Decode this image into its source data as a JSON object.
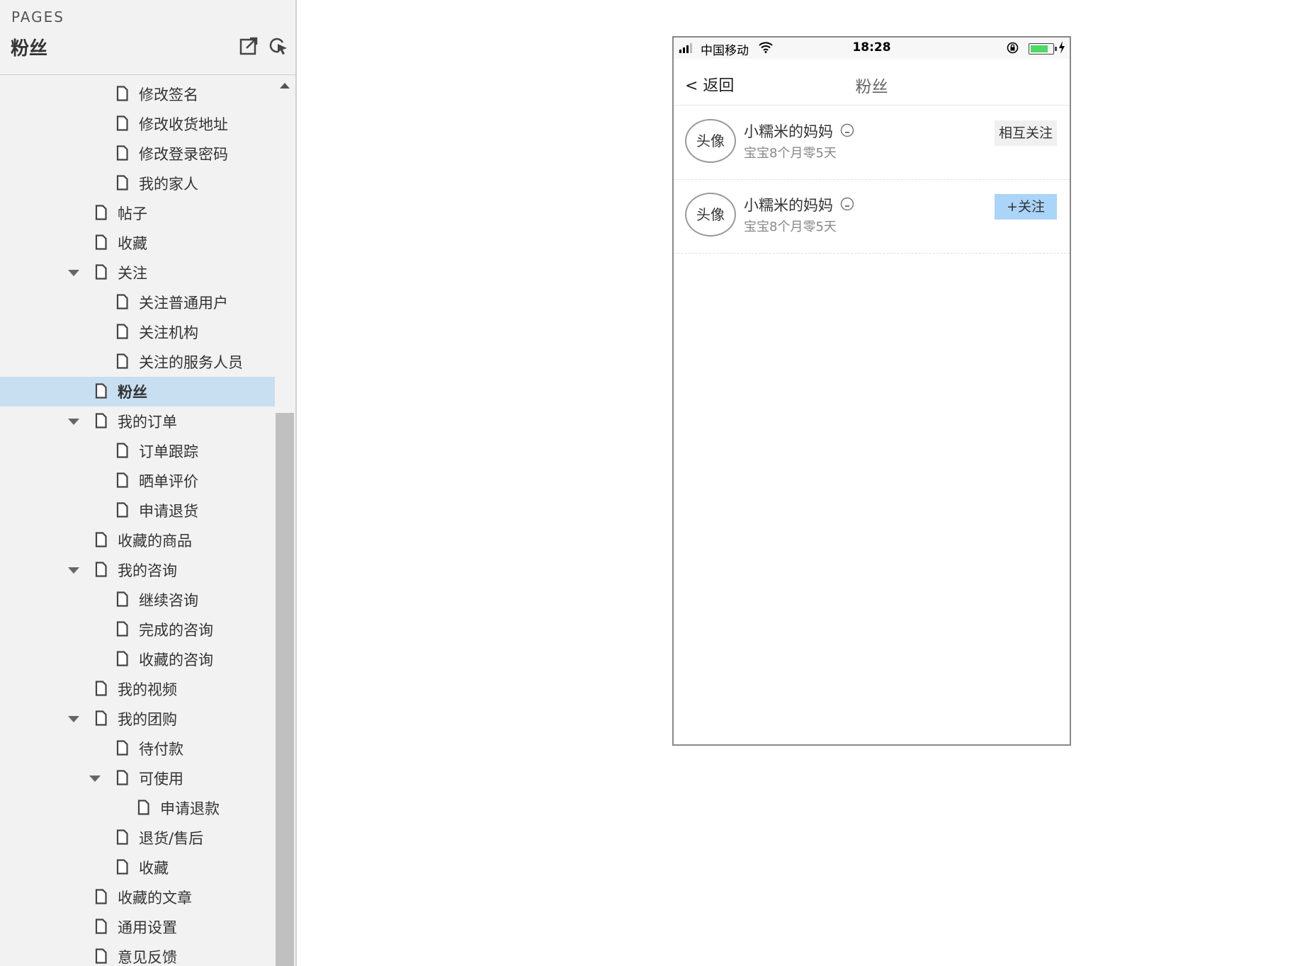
{
  "sidebar": {
    "section_label": "PAGES",
    "title": "粉丝",
    "icons": [
      "export-icon",
      "navigate-icon"
    ],
    "tree": [
      {
        "label": "修改签名",
        "level": 2,
        "expanded": null
      },
      {
        "label": "修改收货地址",
        "level": 2,
        "expanded": null
      },
      {
        "label": "修改登录密码",
        "level": 2,
        "expanded": null
      },
      {
        "label": "我的家人",
        "level": 2,
        "expanded": null
      },
      {
        "label": "帖子",
        "level": 1,
        "expanded": null
      },
      {
        "label": "收藏",
        "level": 1,
        "expanded": null
      },
      {
        "label": "关注",
        "level": 1,
        "expanded": true
      },
      {
        "label": "关注普通用户",
        "level": 2,
        "expanded": null
      },
      {
        "label": "关注机构",
        "level": 2,
        "expanded": null
      },
      {
        "label": "关注的服务人员",
        "level": 2,
        "expanded": null
      },
      {
        "label": "粉丝",
        "level": 1,
        "expanded": null,
        "selected": true
      },
      {
        "label": "我的订单",
        "level": 1,
        "expanded": true
      },
      {
        "label": "订单跟踪",
        "level": 2,
        "expanded": null
      },
      {
        "label": "晒单评价",
        "level": 2,
        "expanded": null
      },
      {
        "label": "申请退货",
        "level": 2,
        "expanded": null
      },
      {
        "label": "收藏的商品",
        "level": 1,
        "expanded": null
      },
      {
        "label": "我的咨询",
        "level": 1,
        "expanded": true
      },
      {
        "label": "继续咨询",
        "level": 2,
        "expanded": null
      },
      {
        "label": "完成的咨询",
        "level": 2,
        "expanded": null
      },
      {
        "label": "收藏的咨询",
        "level": 2,
        "expanded": null
      },
      {
        "label": "我的视频",
        "level": 1,
        "expanded": null
      },
      {
        "label": "我的团购",
        "level": 1,
        "expanded": true
      },
      {
        "label": "待付款",
        "level": 2,
        "expanded": null
      },
      {
        "label": "可使用",
        "level": 2,
        "expanded": true
      },
      {
        "label": "申请退款",
        "level": 3,
        "expanded": null
      },
      {
        "label": "退货/售后",
        "level": 2,
        "expanded": null
      },
      {
        "label": "收藏",
        "level": 2,
        "expanded": null
      },
      {
        "label": "收藏的文章",
        "level": 1,
        "expanded": null
      },
      {
        "label": "通用设置",
        "level": 1,
        "expanded": null
      },
      {
        "label": "意见反馈",
        "level": 1,
        "expanded": null
      }
    ]
  },
  "phone": {
    "status": {
      "carrier": "中国移动",
      "time": "18:28",
      "battery_level": 0.8,
      "battery_color": "#4cd964"
    },
    "nav": {
      "back_label": "< 返回",
      "title": "粉丝"
    },
    "fans": [
      {
        "avatar": "头像",
        "name": "小糯米的妈妈",
        "sub": "宝宝8个月零5天",
        "button": "相互关注",
        "button_style": "mutual"
      },
      {
        "avatar": "头像",
        "name": "小糯米的妈妈",
        "sub": "宝宝8个月零5天",
        "button": "+关注",
        "button_style": "follow"
      }
    ]
  },
  "colors": {
    "selected_bg": "#c8dff2",
    "follow_button": "#aad4f8",
    "mutual_button": "#f0f0f0"
  }
}
